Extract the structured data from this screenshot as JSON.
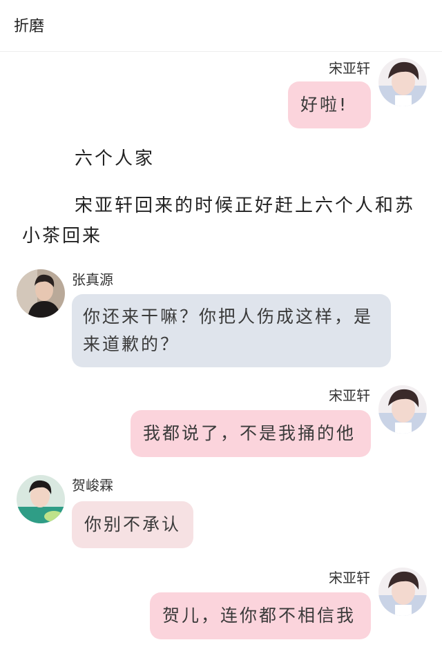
{
  "header": {
    "title": "折磨"
  },
  "messages": {
    "m1": {
      "sender": "宋亚轩",
      "text": "好啦!"
    },
    "m2": {
      "sender": "张真源",
      "text": "你还来干嘛？你把人伤成这样，是来道歉的？"
    },
    "m3": {
      "sender": "宋亚轩",
      "text": "我都说了，不是我捅的他"
    },
    "m4": {
      "sender": "贺峻霖",
      "text": "你别不承认"
    },
    "m5": {
      "sender": "宋亚轩",
      "text": "贺儿，连你都不相信我"
    }
  },
  "narration": {
    "line1": "六个人家",
    "line2": "宋亚轩回来的时候正好赶上六个人和苏小茶回来"
  },
  "avatars": {
    "songyaxuan": "portrait-avatar",
    "zhangzhenyuan": "portrait-avatar",
    "hejunlin": "portrait-avatar"
  },
  "colors": {
    "bubble_pink": "#fbd4dc",
    "bubble_blue": "#dfe4ec",
    "bubble_rose": "#f6e1e3"
  }
}
